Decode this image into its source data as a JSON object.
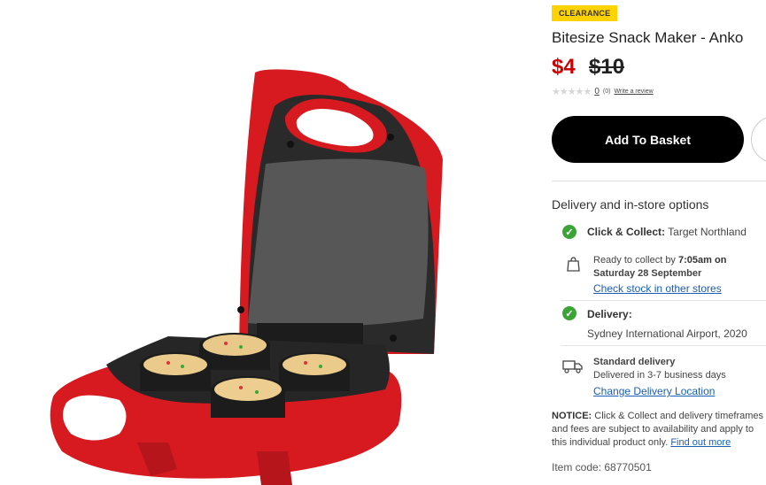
{
  "product": {
    "badge": "CLEARANCE",
    "title": "Bitesize Snack Maker - Anko",
    "price_now": "$4",
    "price_was": "$10",
    "rating_stars": "★★★★★",
    "review_count_link": "0",
    "review_count_paren": "(0)",
    "write_review": "Write a review",
    "add_to_basket": "Add To Basket"
  },
  "delivery": {
    "heading": "Delivery and in-store options",
    "click_collect_label": "Click & Collect:",
    "click_collect_store": "Target Northland",
    "ready_prefix": "Ready to collect by",
    "ready_time": "7:05am on",
    "ready_day": "Saturday 28 September",
    "check_stock": "Check stock in other stores",
    "delivery_label": "Delivery:",
    "delivery_location": "Sydney International Airport, 2020",
    "standard_label": "Standard delivery",
    "standard_days": "Delivered in 3-7 business days",
    "change_location": "Change Delivery Location"
  },
  "notice": {
    "label": "NOTICE:",
    "text": " Click & Collect and delivery timeframes and fees are subject to availability and apply to this individual product only. ",
    "link": "Find out more"
  },
  "item_code": "Item code: 68770501",
  "colors": {
    "accent_red": "#cc0000",
    "badge_yellow": "#ffd200",
    "check_green": "#3ba437",
    "link_blue": "#1a5fb4"
  }
}
